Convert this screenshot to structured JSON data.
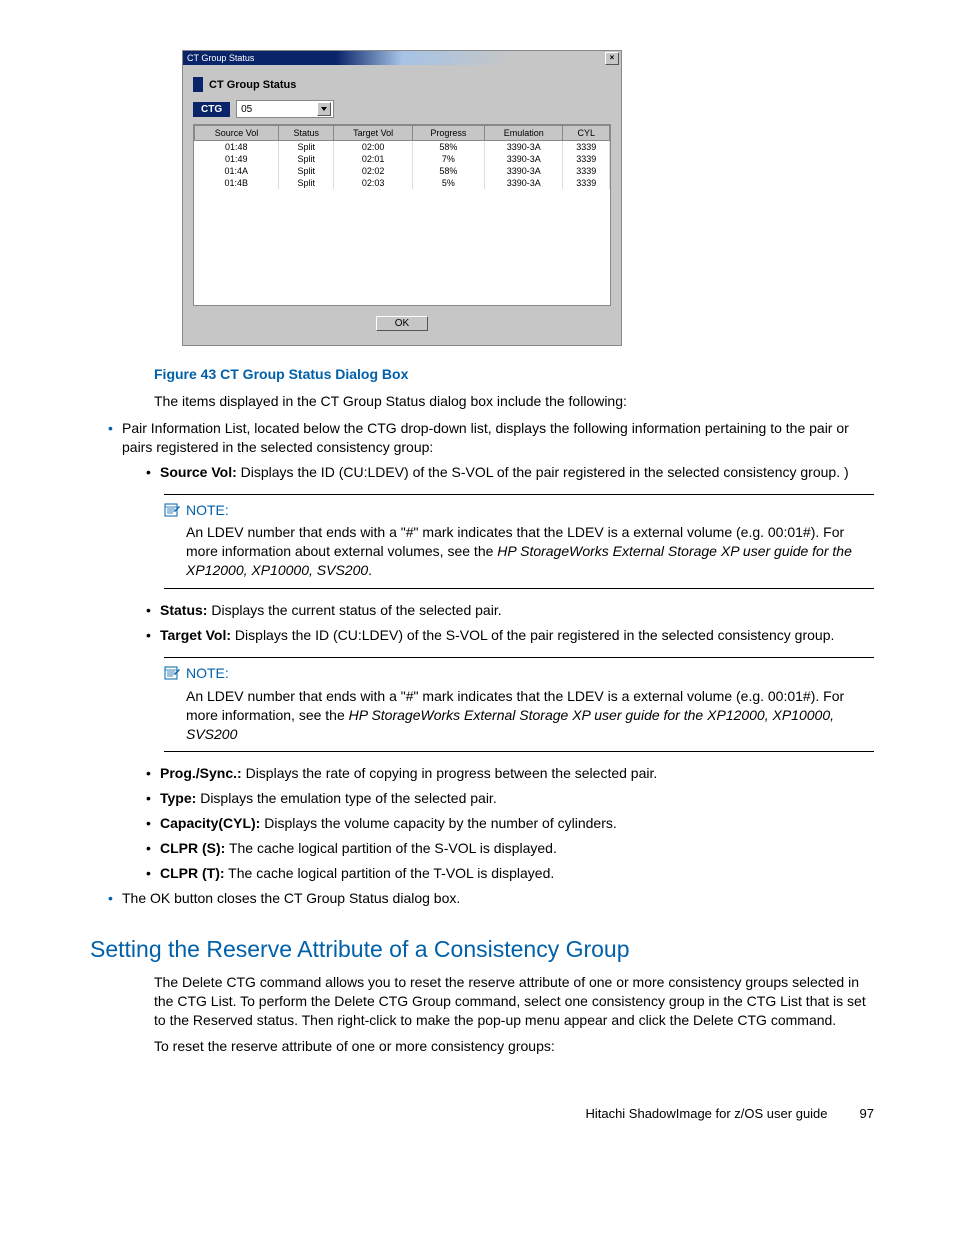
{
  "dialog": {
    "titlebar": "CT Group Status",
    "header": "CT Group Status",
    "ctg_label": "CTG",
    "ctg_value": "05",
    "columns": [
      "Source Vol",
      "Status",
      "Target Vol",
      "Progress",
      "Emulation",
      "CYL"
    ],
    "rows": [
      [
        "01:48",
        "Split",
        "02:00",
        "58%",
        "3390-3A",
        "3339"
      ],
      [
        "01:49",
        "Split",
        "02:01",
        "7%",
        "3390-3A",
        "3339"
      ],
      [
        "01:4A",
        "Split",
        "02:02",
        "58%",
        "3390-3A",
        "3339"
      ],
      [
        "01:4B",
        "Split",
        "02:03",
        "5%",
        "3390-3A",
        "3339"
      ]
    ],
    "ok": "OK"
  },
  "caption": "Figure 43 CT Group Status Dialog Box",
  "intro": "The items displayed in the CT Group Status dialog box include the following:",
  "pairinfo": "Pair Information List, located below the CTG drop-down list, displays the following information pertaining to the pair or pairs registered in the selected consistency group:",
  "items": {
    "sourcevol_label": "Source Vol:",
    "sourcevol_text": " Displays the ID (CU:LDEV) of the S-VOL of the pair registered in the selected consistency group.  )",
    "status_label": "Status:",
    "status_text": " Displays the current status of the selected pair.",
    "targetvol_label": "Target Vol:",
    "targetvol_text": " Displays the ID (CU:LDEV) of the S-VOL of the pair registered in the selected consistency group.",
    "prog_label": "Prog./Sync.:",
    "prog_text": " Displays the rate of copying in progress between the selected pair.",
    "type_label": "Type:",
    "type_text": " Displays the emulation type of the selected pair.",
    "cap_label": "Capacity(CYL):",
    "cap_text": " Displays the volume capacity by the number of cylinders.",
    "clprs_label": "CLPR (S):",
    "clprs_text": " The cache logical partition of the S-VOL is displayed.",
    "clprt_label": "CLPR (T):",
    "clprt_text": " The cache logical partition of the T-VOL is displayed."
  },
  "ok_item": "The OK button closes the CT Group Status dialog box.",
  "note_label": "NOTE:",
  "note1_a": "An LDEV number that ends with a \"#\" mark indicates that the LDEV is a external volume (e.g. 00:01#).  For more information about external volumes, see the ",
  "note1_b": "HP StorageWorks External Storage XP user guide for the XP12000, XP10000, SVS200",
  "note1_c": ".",
  "note2_a": "An LDEV number that ends with a \"#\" mark indicates that the LDEV is a external volume (e.g. 00:01#).  For more information, see the ",
  "note2_b": "HP StorageWorks External Storage XP user guide for the XP12000, XP10000, SVS200",
  "section_title": "Setting the Reserve Attribute of a Consistency Group",
  "section_p1": "The Delete CTG command allows you to reset the reserve attribute of one or more consistency groups selected in the CTG List.  To perform the Delete CTG Group command, select one consistency group in the CTG List that is set to the Reserved status.  Then right-click to make the pop-up menu appear and click the Delete CTG command.",
  "section_p2": "To reset the reserve attribute of one or more consistency groups:",
  "footer_text": "Hitachi ShadowImage for z/OS user guide",
  "footer_page": "97"
}
